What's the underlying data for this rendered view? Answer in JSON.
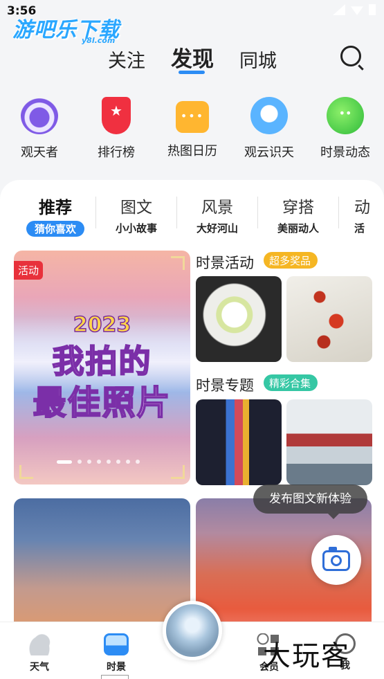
{
  "status_bar": {
    "time": "3:56"
  },
  "watermark": {
    "brand": "游吧乐下载",
    "domain": "y8l.com",
    "bottom_brand": "大玩客"
  },
  "top_tabs": [
    {
      "label": "关注",
      "active": false
    },
    {
      "label": "发现",
      "active": true
    },
    {
      "label": "同城",
      "active": false
    }
  ],
  "quick_entries": [
    {
      "label": "观天者",
      "icon": "eye-icon"
    },
    {
      "label": "排行榜",
      "icon": "trophy-icon"
    },
    {
      "label": "热图日历",
      "icon": "calendar-icon"
    },
    {
      "label": "观云识天",
      "icon": "cloud-icon"
    },
    {
      "label": "时景动态",
      "icon": "planet-icon"
    }
  ],
  "categories": [
    {
      "name": "推荐",
      "sub": "猜你喜欢",
      "active": true
    },
    {
      "name": "图文",
      "sub": "小小故事"
    },
    {
      "name": "风景",
      "sub": "大好河山"
    },
    {
      "name": "穿搭",
      "sub": "美丽动人"
    },
    {
      "name": "动",
      "sub": "活"
    }
  ],
  "banner": {
    "badge": "活动",
    "year": "2023",
    "line1": "我拍的",
    "line2": "最佳照片",
    "slide_count": 8,
    "active_slide": 1
  },
  "sections": {
    "activity": {
      "title": "时景活动",
      "pill": "超多奖品"
    },
    "topics": {
      "title": "时景专题",
      "pill": "精彩合集"
    }
  },
  "tooltip": {
    "text": "发布图文新体验"
  },
  "bottom_nav": [
    {
      "label": "天气",
      "icon": "cloud-icon"
    },
    {
      "label": "时景",
      "icon": "photo-icon",
      "active": true
    },
    {
      "label": "会员",
      "icon": "grid-icon"
    },
    {
      "label": "我",
      "icon": "profile-icon"
    }
  ],
  "colors": {
    "accent": "#2c8cf4",
    "activity_badge": "#e8313b",
    "pill_gold": "#f5b623",
    "pill_teal": "#35c7a4"
  }
}
